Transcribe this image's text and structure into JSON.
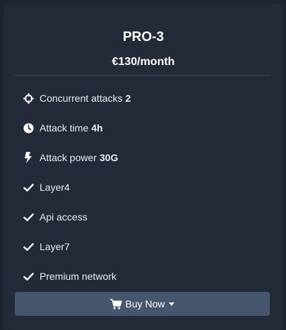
{
  "plan": {
    "title": "PRO-3",
    "price": "€130/month"
  },
  "features": [
    {
      "icon": "crosshair-icon",
      "label": "Concurrent attacks",
      "value": "2"
    },
    {
      "icon": "clock-icon",
      "label": "Attack time",
      "value": "4h"
    },
    {
      "icon": "bolt-icon",
      "label": "Attack power",
      "value": "30G"
    },
    {
      "icon": "check-icon",
      "label": "Layer4",
      "value": ""
    },
    {
      "icon": "check-icon",
      "label": "Api access",
      "value": ""
    },
    {
      "icon": "check-icon",
      "label": "Layer7",
      "value": ""
    },
    {
      "icon": "check-icon",
      "label": "Premium network",
      "value": ""
    }
  ],
  "actions": {
    "buy_label": "Buy Now"
  },
  "colors": {
    "background": "#1e2530",
    "card": "#232b38",
    "button": "#46566d",
    "text": "#e9edf2"
  }
}
